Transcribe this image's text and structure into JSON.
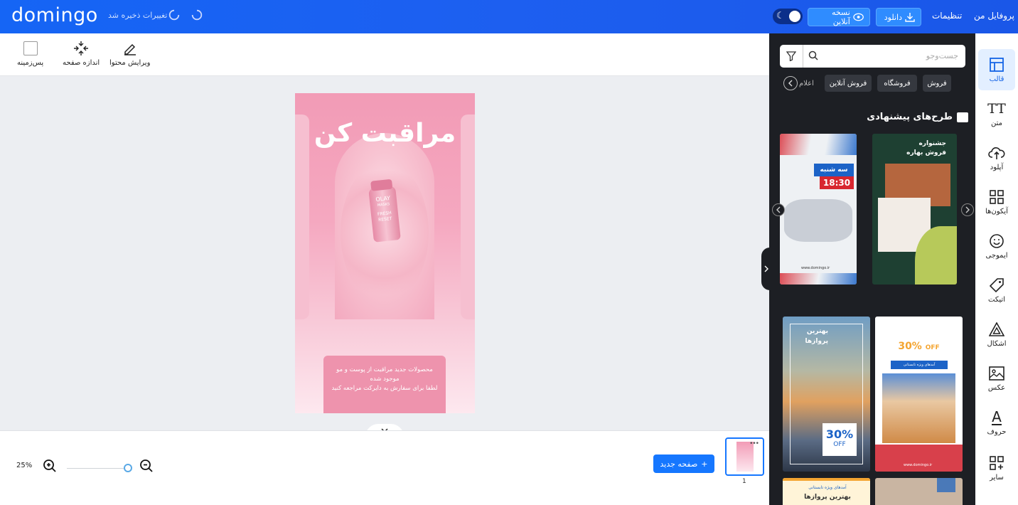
{
  "app": {
    "logo": "domingo",
    "save_status": "تغییرات ذخیره شد"
  },
  "topbar": {
    "online_version": "نسخه آنلاین",
    "download": "دانلود",
    "settings": "تنظیمات",
    "profile": "پروفایل من"
  },
  "toolbar": {
    "background": "پس‌زمینه",
    "page_size": "اندازه صفحه",
    "edit_content": "ویرایش محتوا"
  },
  "design": {
    "headline": "مراقبت کن",
    "product_brand": "OLAY",
    "product_sub": "MASKS",
    "product_name_1": "FRESH",
    "product_name_2": "RESET",
    "card_line1": "محصولات جدید مراقبت از پوست و مو",
    "card_line2": "موجود شده",
    "card_line3": "لطفا برای سفارش به دایرکت مراجعه کنید",
    "colors": {
      "primary": "#f29bb6",
      "card": "#ee93ad"
    }
  },
  "bottom": {
    "zoom": "25%",
    "zoom_level": 0.25,
    "new_page": "صفحه جدید",
    "page_number": "1"
  },
  "panel": {
    "search_placeholder": "جست‌وجو",
    "chips": [
      "فروش",
      "فروشگاه",
      "فروش آنلاین",
      "اعلام"
    ],
    "section_title": "طرح‌های پیشنهادی",
    "templates": [
      {
        "line1": "سه شنبه",
        "line2": "18:30",
        "footer": "www.domingo.ir"
      },
      {
        "line1": "جشنواره",
        "line2": "فروش بهاره"
      },
      {
        "line1": "بهترین",
        "line2": "پروازها",
        "badge": "30%",
        "badge_sub": "OFF"
      },
      {
        "badge": "30%",
        "badge_sub": "OFF",
        "band": "آمدهای ویژه تابستانی",
        "footer": "www.domingo.ir"
      },
      {
        "line1": "آمدهای ویژه تابستانی",
        "line2": "بهترین پروازها"
      }
    ]
  },
  "sidebar": {
    "items": [
      {
        "label": "قالب",
        "icon": "template-icon",
        "active": true
      },
      {
        "label": "متن",
        "icon": "text-icon"
      },
      {
        "label": "آپلود",
        "icon": "upload-icon"
      },
      {
        "label": "آیکون‌ها",
        "icon": "icons-grid-icon"
      },
      {
        "label": "ایموجی",
        "icon": "emoji-icon"
      },
      {
        "label": "اتیکت",
        "icon": "tag-icon"
      },
      {
        "label": "اشکال",
        "icon": "shapes-icon"
      },
      {
        "label": "عکس",
        "icon": "image-icon"
      },
      {
        "label": "حروف",
        "icon": "letter-icon"
      },
      {
        "label": "سایر",
        "icon": "more-icon"
      }
    ],
    "active_color": "#1464e6"
  }
}
